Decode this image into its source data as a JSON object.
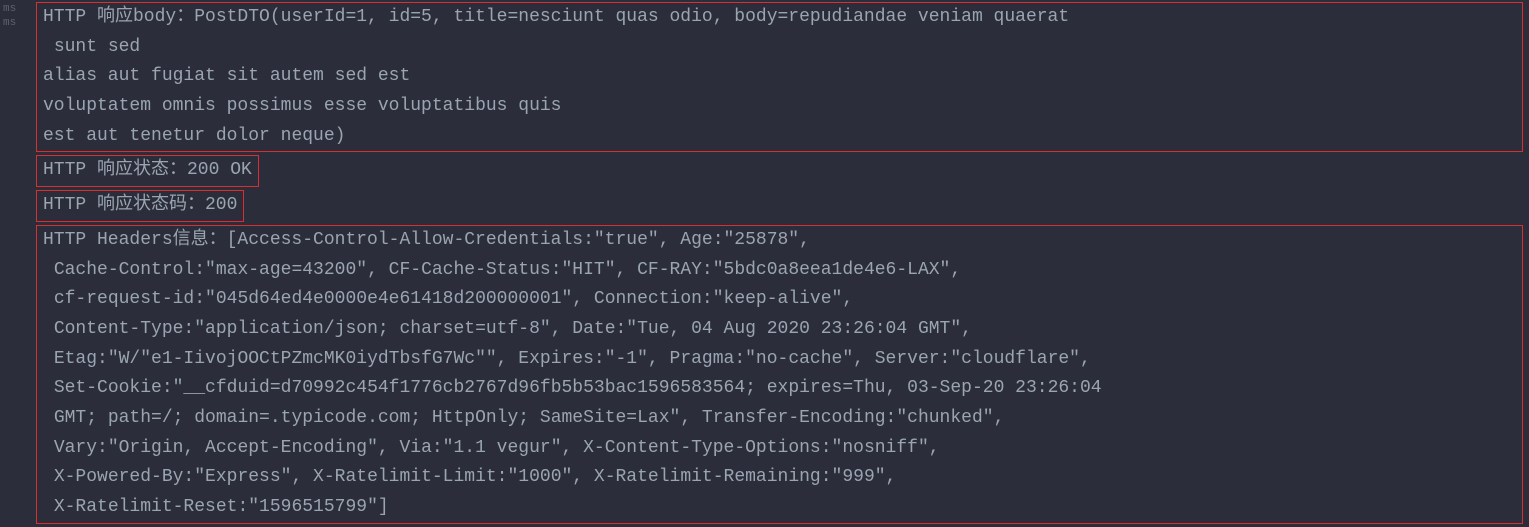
{
  "gutter": {
    "label1": "ms",
    "label2": "ms"
  },
  "logs": {
    "body_line": "HTTP 响应body：PostDTO(userId=1, id=5, title=nesciunt quas odio, body=repudiandae veniam quaerat\n sunt sed\nalias aut fugiat sit autem sed est\nvoluptatem omnis possimus esse voluptatibus quis\nest aut tenetur dolor neque)",
    "status_line": "HTTP 响应状态：200 OK",
    "status_code_line": "HTTP 响应状态码：200",
    "headers_line": "HTTP Headers信息：[Access-Control-Allow-Credentials:\"true\", Age:\"25878\",\n Cache-Control:\"max-age=43200\", CF-Cache-Status:\"HIT\", CF-RAY:\"5bdc0a8eea1de4e6-LAX\",\n cf-request-id:\"045d64ed4e0000e4e61418d200000001\", Connection:\"keep-alive\",\n Content-Type:\"application/json; charset=utf-8\", Date:\"Tue, 04 Aug 2020 23:26:04 GMT\",\n Etag:\"W/\"e1-IivojOOCtPZmcMK0iydTbsfG7Wc\"\", Expires:\"-1\", Pragma:\"no-cache\", Server:\"cloudflare\",\n Set-Cookie:\"__cfduid=d70992c454f1776cb2767d96fb5b53bac1596583564; expires=Thu, 03-Sep-20 23:26:04\n GMT; path=/; domain=.typicode.com; HttpOnly; SameSite=Lax\", Transfer-Encoding:\"chunked\",\n Vary:\"Origin, Accept-Encoding\", Via:\"1.1 vegur\", X-Content-Type-Options:\"nosniff\",\n X-Powered-By:\"Express\", X-Ratelimit-Limit:\"1000\", X-Ratelimit-Remaining:\"999\",\n X-Ratelimit-Reset:\"1596515799\"]"
  }
}
